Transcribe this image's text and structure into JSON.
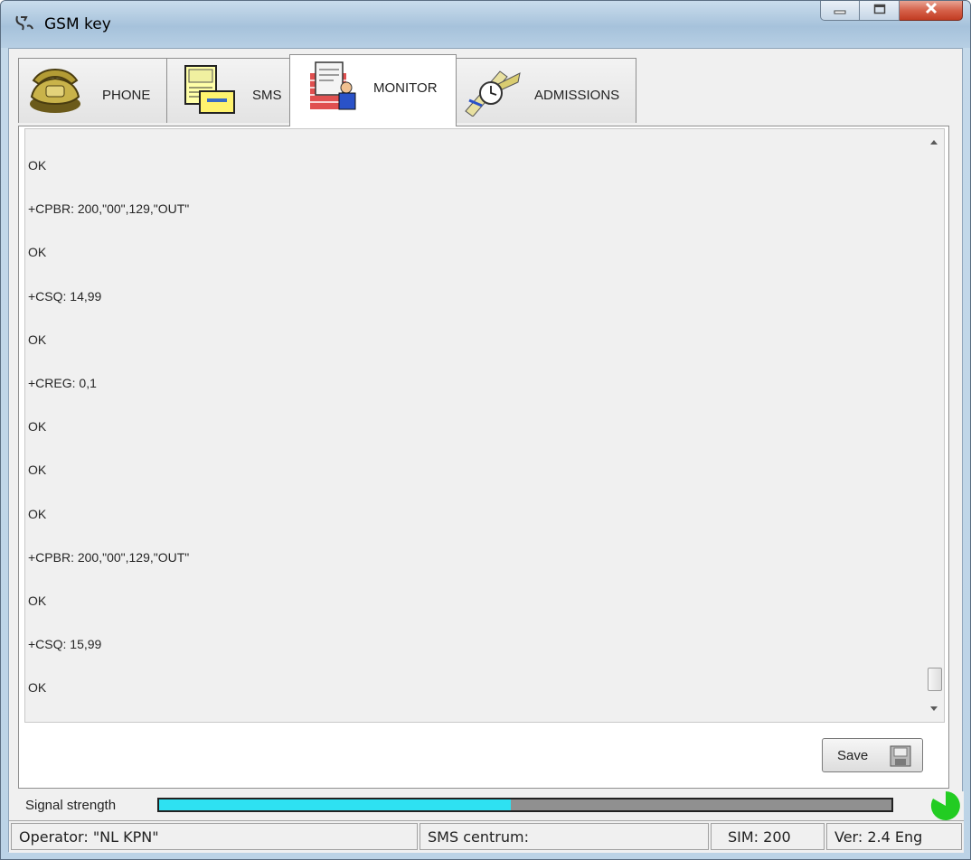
{
  "window": {
    "title": "GSM key",
    "controls": {
      "minimize": "minimize-icon",
      "maximize": "maximize-icon",
      "close": "close-icon"
    }
  },
  "tabs": [
    {
      "label": "PHONE",
      "icon": "telephone-icon"
    },
    {
      "label": "SMS",
      "icon": "sms-letter-icon"
    },
    {
      "label": "MONITOR",
      "icon": "monitor-report-icon",
      "active": true
    },
    {
      "label": "ADMISSIONS",
      "icon": "watch-admissions-icon"
    }
  ],
  "monitor": {
    "lines": [
      "OK",
      "+CPBR: 200,\"00\",129,\"OUT\"",
      "OK",
      "+CSQ: 14,99",
      "OK",
      "+CREG: 0,1",
      "OK",
      "OK",
      "OK",
      "+CPBR: 200,\"00\",129,\"OUT\"",
      "OK",
      "+CSQ: 15,99",
      "OK"
    ]
  },
  "save_button": {
    "label": "Save",
    "icon": "floppy-disk-icon"
  },
  "signal": {
    "label": "Signal strength",
    "level_fraction": 0.48,
    "fill_color": "#2ee1f2",
    "indicator_color": "#22cc22"
  },
  "statusbar": {
    "operator": "Operator: \"NL KPN\"",
    "sms_centrum": "SMS centrum:",
    "sim": "SIM: 200",
    "version": "Ver: 2.4  Eng"
  }
}
